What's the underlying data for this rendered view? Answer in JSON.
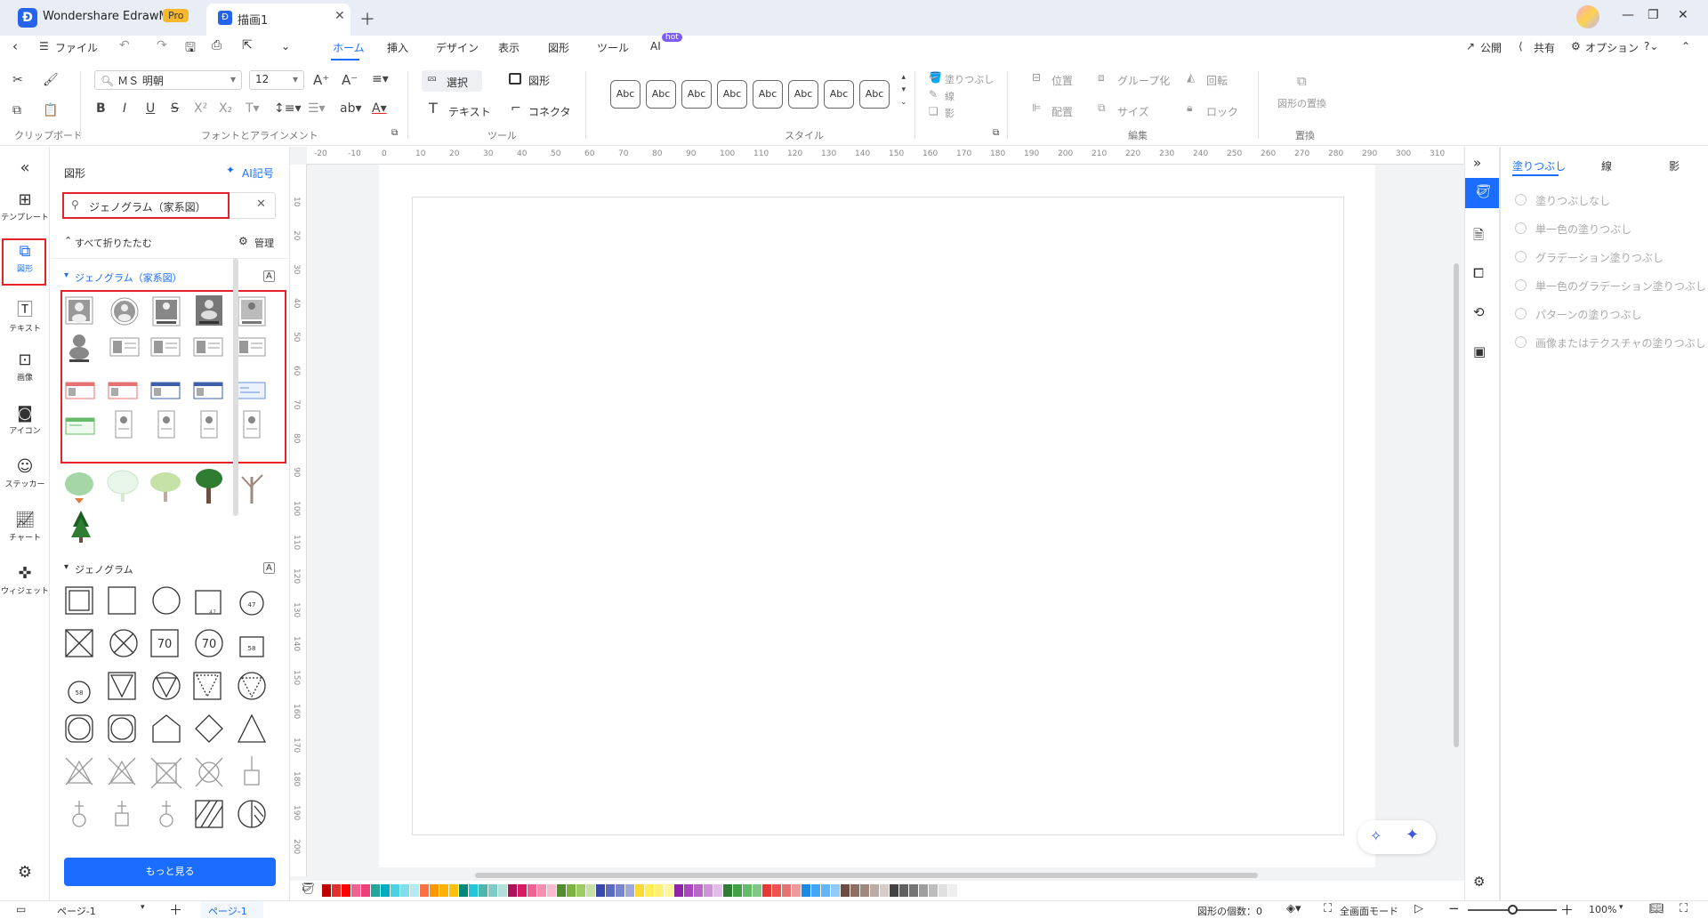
{
  "titlebar": {
    "app_name": "Wondershare EdrawMax",
    "pro_badge": "Pro",
    "doc_tab": "描画1"
  },
  "menubar": {
    "file": "ファイル",
    "tabs": [
      "ホーム",
      "挿入",
      "デザイン",
      "表示",
      "図形",
      "ツール",
      "AI"
    ],
    "ai_badge": "hot",
    "right": {
      "publish": "公開",
      "share": "共有",
      "options": "オプション"
    }
  },
  "ribbon": {
    "font_name": "ＭＳ 明朝",
    "font_size": "12",
    "select": "選択",
    "shape": "図形",
    "text": "テキスト",
    "connector": "コネクタ",
    "style_sample": "Abc",
    "fill": "塗りつぶし",
    "line": "線",
    "shadow": "影",
    "position": "位置",
    "group": "グループ化",
    "rotate": "回転",
    "align": "配置",
    "size": "サイズ",
    "lock": "ロック",
    "replace_shape": "図形の置換",
    "groups": {
      "clipboard": "クリップボード",
      "font": "フォントとアラインメント",
      "tools": "ツール",
      "style": "スタイル",
      "edit": "編集",
      "replace": "置換"
    }
  },
  "leftbar": {
    "items": [
      "テンプレート",
      "図形",
      "テキスト",
      "画像",
      "アイコン",
      "ステッカー",
      "チャート",
      "ウィジェット"
    ]
  },
  "panel": {
    "title": "図形",
    "ai_symbol": "AI記号",
    "search_value": "ジェノグラム（家系図）",
    "collapse_all": "すべて折りたたむ",
    "manage": "管理",
    "section1": "ジェノグラム（家系図）",
    "section2": "ジェノグラム",
    "more": "もっと見る",
    "shape_numbers": [
      "47",
      "47",
      "70",
      "70",
      "58",
      "58"
    ]
  },
  "ruler": {
    "top": [
      "-20",
      "-10",
      "0",
      "10",
      "20",
      "30",
      "40",
      "50",
      "60",
      "70",
      "80",
      "90",
      "100",
      "110",
      "120",
      "130",
      "140",
      "150",
      "160",
      "170",
      "180",
      "190",
      "200",
      "210",
      "220",
      "230",
      "240",
      "250",
      "260",
      "270",
      "280",
      "290",
      "300",
      "310"
    ],
    "left": [
      "10",
      "20",
      "30",
      "40",
      "50",
      "60",
      "70",
      "80",
      "90",
      "100",
      "110",
      "120",
      "130",
      "140",
      "150",
      "160",
      "170",
      "180",
      "190",
      "200"
    ]
  },
  "rpanel": {
    "tabs": [
      "塗りつぶし",
      "線",
      "影"
    ],
    "options": [
      "塗りつぶしなし",
      "単一色の塗りつぶし",
      "グラデーション塗りつぶし",
      "単一色のグラデーション塗りつぶし",
      "パターンの塗りつぶし",
      "画像またはテクスチャの塗りつぶし"
    ]
  },
  "statusbar": {
    "page_select": "ページ-1",
    "page_tab": "ページ-1",
    "shape_count": "図形の個数：0",
    "fullscreen": "全画面モード",
    "zoom": "100%"
  },
  "colors": {
    "accent": "#1a6dff",
    "highlight": "#e3222b",
    "palette": [
      "#c00000",
      "#e03131",
      "#ff0000",
      "#f06292",
      "#ec407a",
      "#26a69a",
      "#00acc1",
      "#4dd0e1",
      "#80deea",
      "#b2ebf2",
      "#ff7043",
      "#ff9800",
      "#ffb300",
      "#ffc107",
      "#00897b",
      "#26c6da",
      "#4db6ac",
      "#80cbc4",
      "#b2dfdb",
      "#ad1457",
      "#d81b60",
      "#f06292",
      "#f48fb1",
      "#f8bbd0",
      "#558b2f",
      "#7cb342",
      "#9ccc65",
      "#c5e1a5",
      "#3949ab",
      "#5c6bc0",
      "#7986cb",
      "#9fa8da",
      "#fdd835",
      "#ffee58",
      "#fff176",
      "#fff59d",
      "#8e24aa",
      "#ab47bc",
      "#ba68c8",
      "#ce93d8",
      "#e1bee7",
      "#2e7d32",
      "#43a047",
      "#66bb6a",
      "#81c784",
      "#e53935",
      "#ef5350",
      "#e57373",
      "#ef9a9a",
      "#1e88e5",
      "#42a5f5",
      "#64b5f6",
      "#90caf9",
      "#6d4c41",
      "#8d6e63",
      "#a1887f",
      "#bcaaa4",
      "#d7ccc8",
      "#424242",
      "#616161",
      "#757575",
      "#9e9e9e",
      "#bdbdbd",
      "#e0e0e0",
      "#eeeeee"
    ]
  }
}
